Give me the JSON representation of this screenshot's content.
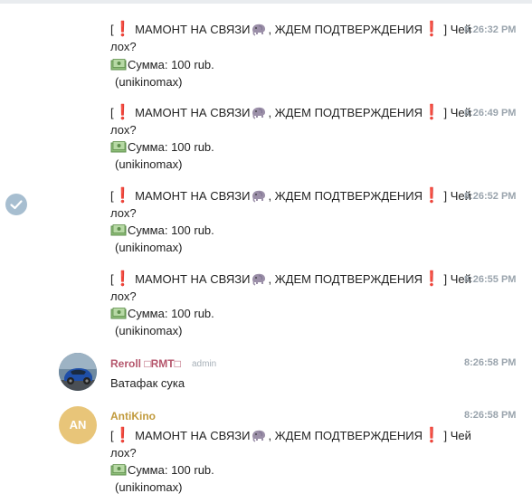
{
  "messages": [
    {
      "time": "8:26:32 PM",
      "text_open": "[",
      "text_bang": "❗",
      "text_mid": " МАМОНТ НА СВЯЗИ",
      "text_mid2": ", ЖДЕМ ПОДТВЕРЖДЕНИЯ",
      "text_close": " ] Чей",
      "line2": "лох?",
      "amount": "Сумма: 100 rub.",
      "user": "(unikinomax)"
    },
    {
      "time": "8:26:49 PM",
      "text_open": "[",
      "text_bang": "❗",
      "text_mid": " МАМОНТ НА СВЯЗИ",
      "text_mid2": ", ЖДЕМ ПОДТВЕРЖДЕНИЯ",
      "text_close": " ] Чей",
      "line2": "лох?",
      "amount": "Сумма: 100 rub.",
      "user": "(unikinomax)"
    },
    {
      "time": "8:26:52 PM",
      "text_open": "[",
      "text_bang": "❗",
      "text_mid": " МАМОНТ НА СВЯЗИ",
      "text_mid2": ", ЖДЕМ ПОДТВЕРЖДЕНИЯ",
      "text_close": " ] Чей",
      "line2": "лох?",
      "amount": "Сумма: 100 rub.",
      "user": "(unikinomax)"
    },
    {
      "time": "8:26:55 PM",
      "text_open": "[",
      "text_bang": "❗",
      "text_mid": " МАМОНТ НА СВЯЗИ",
      "text_mid2": ", ЖДЕМ ПОДТВЕРЖДЕНИЯ",
      "text_close": " ] Чей",
      "line2": "лох?",
      "amount": "Сумма: 100 rub.",
      "user": "(unikinomax)"
    }
  ],
  "reroll": {
    "name": "Reroll □RMT□",
    "role": "admin",
    "time": "8:26:58 PM",
    "text": "Ватафак сука",
    "name_color": "#b5566c"
  },
  "antikino": {
    "name": "AntiKino",
    "initials": "AN",
    "time": "8:26:58 PM",
    "name_color": "#c19a3c",
    "avatar_color": "#e8c579",
    "text_open": "[",
    "text_bang": "❗",
    "text_mid": " МАМОНТ НА СВЯЗИ",
    "text_mid2": ", ЖДЕМ ПОДТВЕРЖДЕНИЯ",
    "text_close": " ] Чей",
    "line2": "лох?",
    "amount": "Сумма: 100 rub.",
    "user": "(unikinomax)"
  },
  "icons": {
    "check": "check-circle-icon",
    "elephant": "elephant-icon",
    "money": "money-icon",
    "exclamation": "red-exclamation-icon"
  },
  "colors": {
    "time": "#9aa4ad",
    "check": "#a7bed0",
    "exclamation": "#e0245e"
  }
}
